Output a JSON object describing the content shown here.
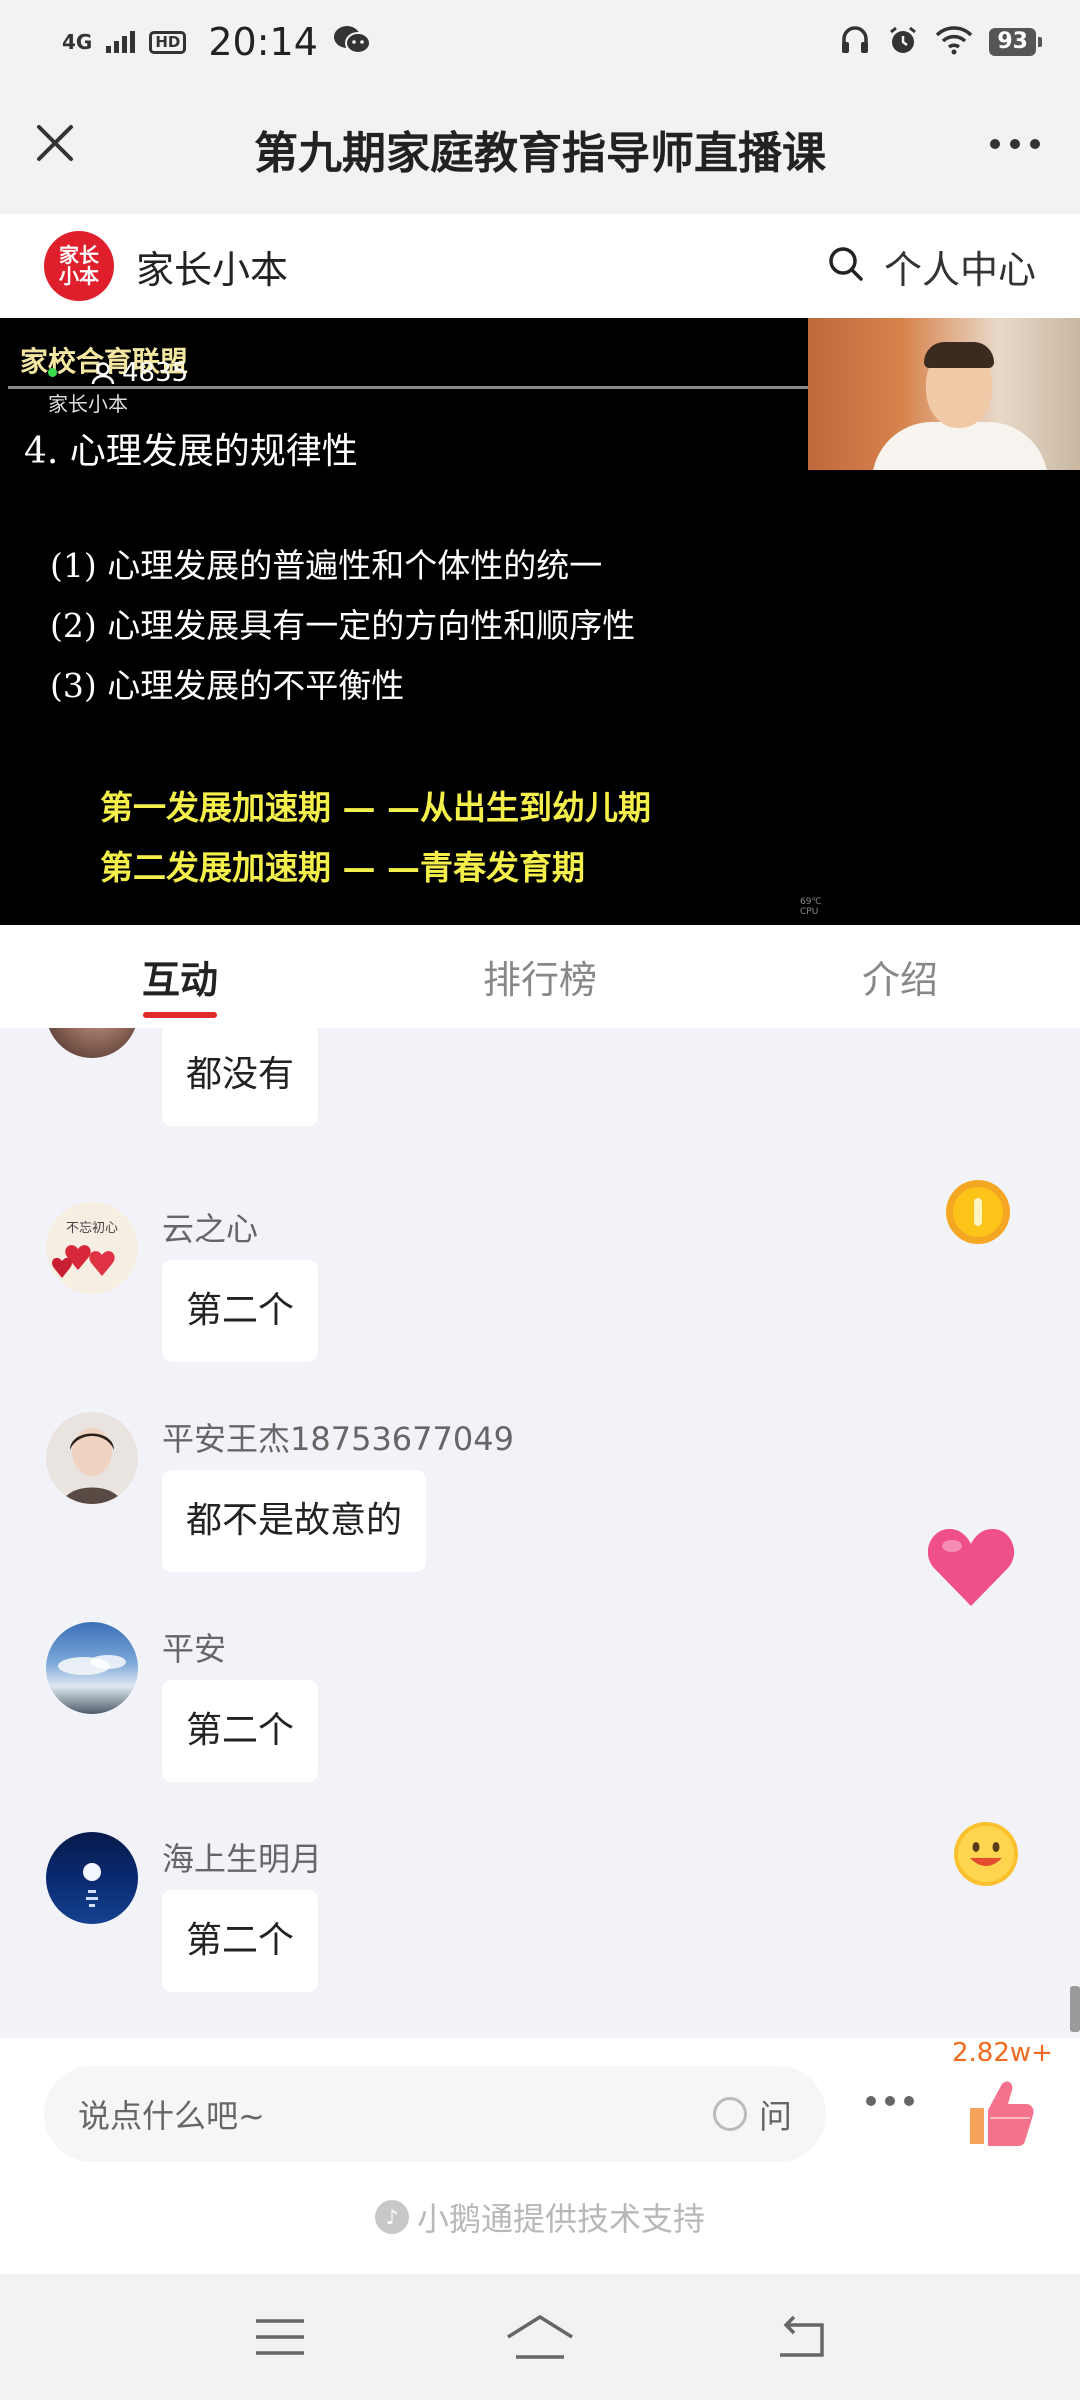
{
  "status_bar": {
    "network": "4G",
    "hd": "HD",
    "time": "20:14",
    "battery": "93"
  },
  "title_bar": {
    "title": "第九期家庭教育指导师直播课"
  },
  "channel": {
    "logo_top": "家长",
    "logo_bottom": "小本",
    "name": "家长小本",
    "personal_center": "个人中心"
  },
  "video": {
    "brand": "家校合育联盟",
    "brand_sub": "家长小本",
    "viewers": "4835",
    "slide_title": "4. 心理发展的规律性",
    "points": [
      "(1) 心理发展的普遍性和个体性的统一",
      "(2) 心理发展具有一定的方向性和顺序性",
      "(3) 心理发展的不平衡性"
    ],
    "highlights": [
      "第一发展加速期 — —从出生到幼儿期",
      "第二发展加速期 — —青春发育期"
    ],
    "cpu_top": "69℃",
    "cpu_bottom": "CPU"
  },
  "tabs": [
    {
      "label": "互动",
      "active": true
    },
    {
      "label": "排行榜",
      "active": false
    },
    {
      "label": "介绍",
      "active": false
    }
  ],
  "messages": [
    {
      "user": "",
      "text": "都没有",
      "avatar": "face-photo"
    },
    {
      "user": "云之心",
      "text": "第二个",
      "avatar": "hearts-card"
    },
    {
      "user": "平安王杰18753677049",
      "text": "都不是故意的",
      "avatar": "woman-photo"
    },
    {
      "user": "平安",
      "text": "第二个",
      "avatar": "sky-clouds"
    },
    {
      "user": "海上生明月",
      "text": "第二个",
      "avatar": "moon-sea"
    }
  ],
  "avatar_text": {
    "hearts_card": "不忘初心"
  },
  "input": {
    "placeholder": "说点什么吧~",
    "ask_label": "问",
    "like_count": "2.82w+"
  },
  "footer": {
    "support_text": "小鹅通提供技术支持"
  },
  "colors": {
    "accent": "#e42b2b",
    "like": "#ef6a1e",
    "chat_bg": "#f2f3f8",
    "logo": "#e01f2c",
    "highlight": "#f4ef4a"
  }
}
